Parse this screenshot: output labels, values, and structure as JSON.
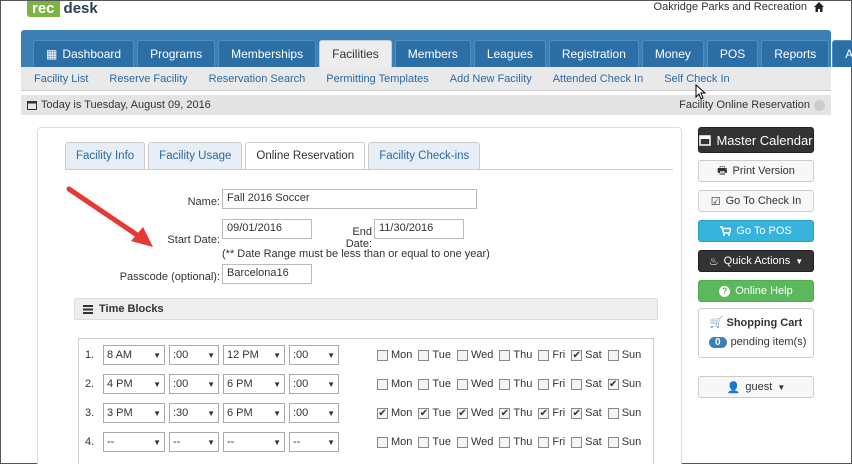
{
  "header": {
    "logo_rec": "rec",
    "logo_desk": "desk",
    "org": "Oakridge Parks and Recreation"
  },
  "nav": {
    "tabs": [
      {
        "label": "Dashboard"
      },
      {
        "label": "Programs"
      },
      {
        "label": "Memberships"
      },
      {
        "label": "Facilities"
      },
      {
        "label": "Members"
      },
      {
        "label": "Leagues"
      },
      {
        "label": "Registration"
      },
      {
        "label": "Money"
      },
      {
        "label": "POS"
      },
      {
        "label": "Reports"
      },
      {
        "label": "Admin"
      }
    ],
    "active": "Facilities"
  },
  "subnav": {
    "items": [
      "Facility List",
      "Reserve Facility",
      "Reservation Search",
      "Permitting Templates",
      "Add New Facility",
      "Attended Check In",
      "Self Check In"
    ]
  },
  "datebar": {
    "today": "Today is Tuesday, August 09, 2016",
    "right": "Facility Online Reservation"
  },
  "panel": {
    "tabs": [
      "Facility Info",
      "Facility Usage",
      "Online Reservation",
      "Facility Check-ins"
    ],
    "active": "Online Reservation"
  },
  "form": {
    "name_label": "Name:",
    "name_value": "Fall 2016 Soccer",
    "start_label": "Start Date:",
    "start_value": "09/01/2016",
    "end_label": "End Date:",
    "end_value": "11/30/2016",
    "note": "(** Date Range must be less than or equal to one year)",
    "passcode_label": "Passcode (optional):",
    "passcode_value": "Barcelona16"
  },
  "timeblocks": {
    "title": "Time Blocks",
    "day_labels": [
      "Mon",
      "Tue",
      "Wed",
      "Thu",
      "Fri",
      "Sat",
      "Sun"
    ],
    "rows": [
      {
        "num": "1.",
        "sh": "8 AM",
        "sm": ":00",
        "eh": "12 PM",
        "em": ":00",
        "days": [
          false,
          false,
          false,
          false,
          false,
          true,
          false
        ]
      },
      {
        "num": "2.",
        "sh": "4 PM",
        "sm": ":00",
        "eh": "6 PM",
        "em": ":00",
        "days": [
          false,
          false,
          false,
          false,
          false,
          false,
          true
        ]
      },
      {
        "num": "3.",
        "sh": "3 PM",
        "sm": ":30",
        "eh": "6 PM",
        "em": ":00",
        "days": [
          true,
          true,
          true,
          true,
          true,
          true,
          false
        ]
      },
      {
        "num": "4.",
        "sh": "--",
        "sm": "--",
        "eh": "--",
        "em": "--",
        "days": [
          false,
          false,
          false,
          false,
          false,
          false,
          false
        ]
      }
    ]
  },
  "sidebar": {
    "master": "Master Calendar",
    "print": "Print Version",
    "checkin": "Go To Check In",
    "pos": "Go To POS",
    "quick": "Quick Actions",
    "help": "Online Help",
    "cart_title": "Shopping Cart",
    "cart_count": "0",
    "cart_text": "pending item(s)",
    "guest": "guest"
  }
}
